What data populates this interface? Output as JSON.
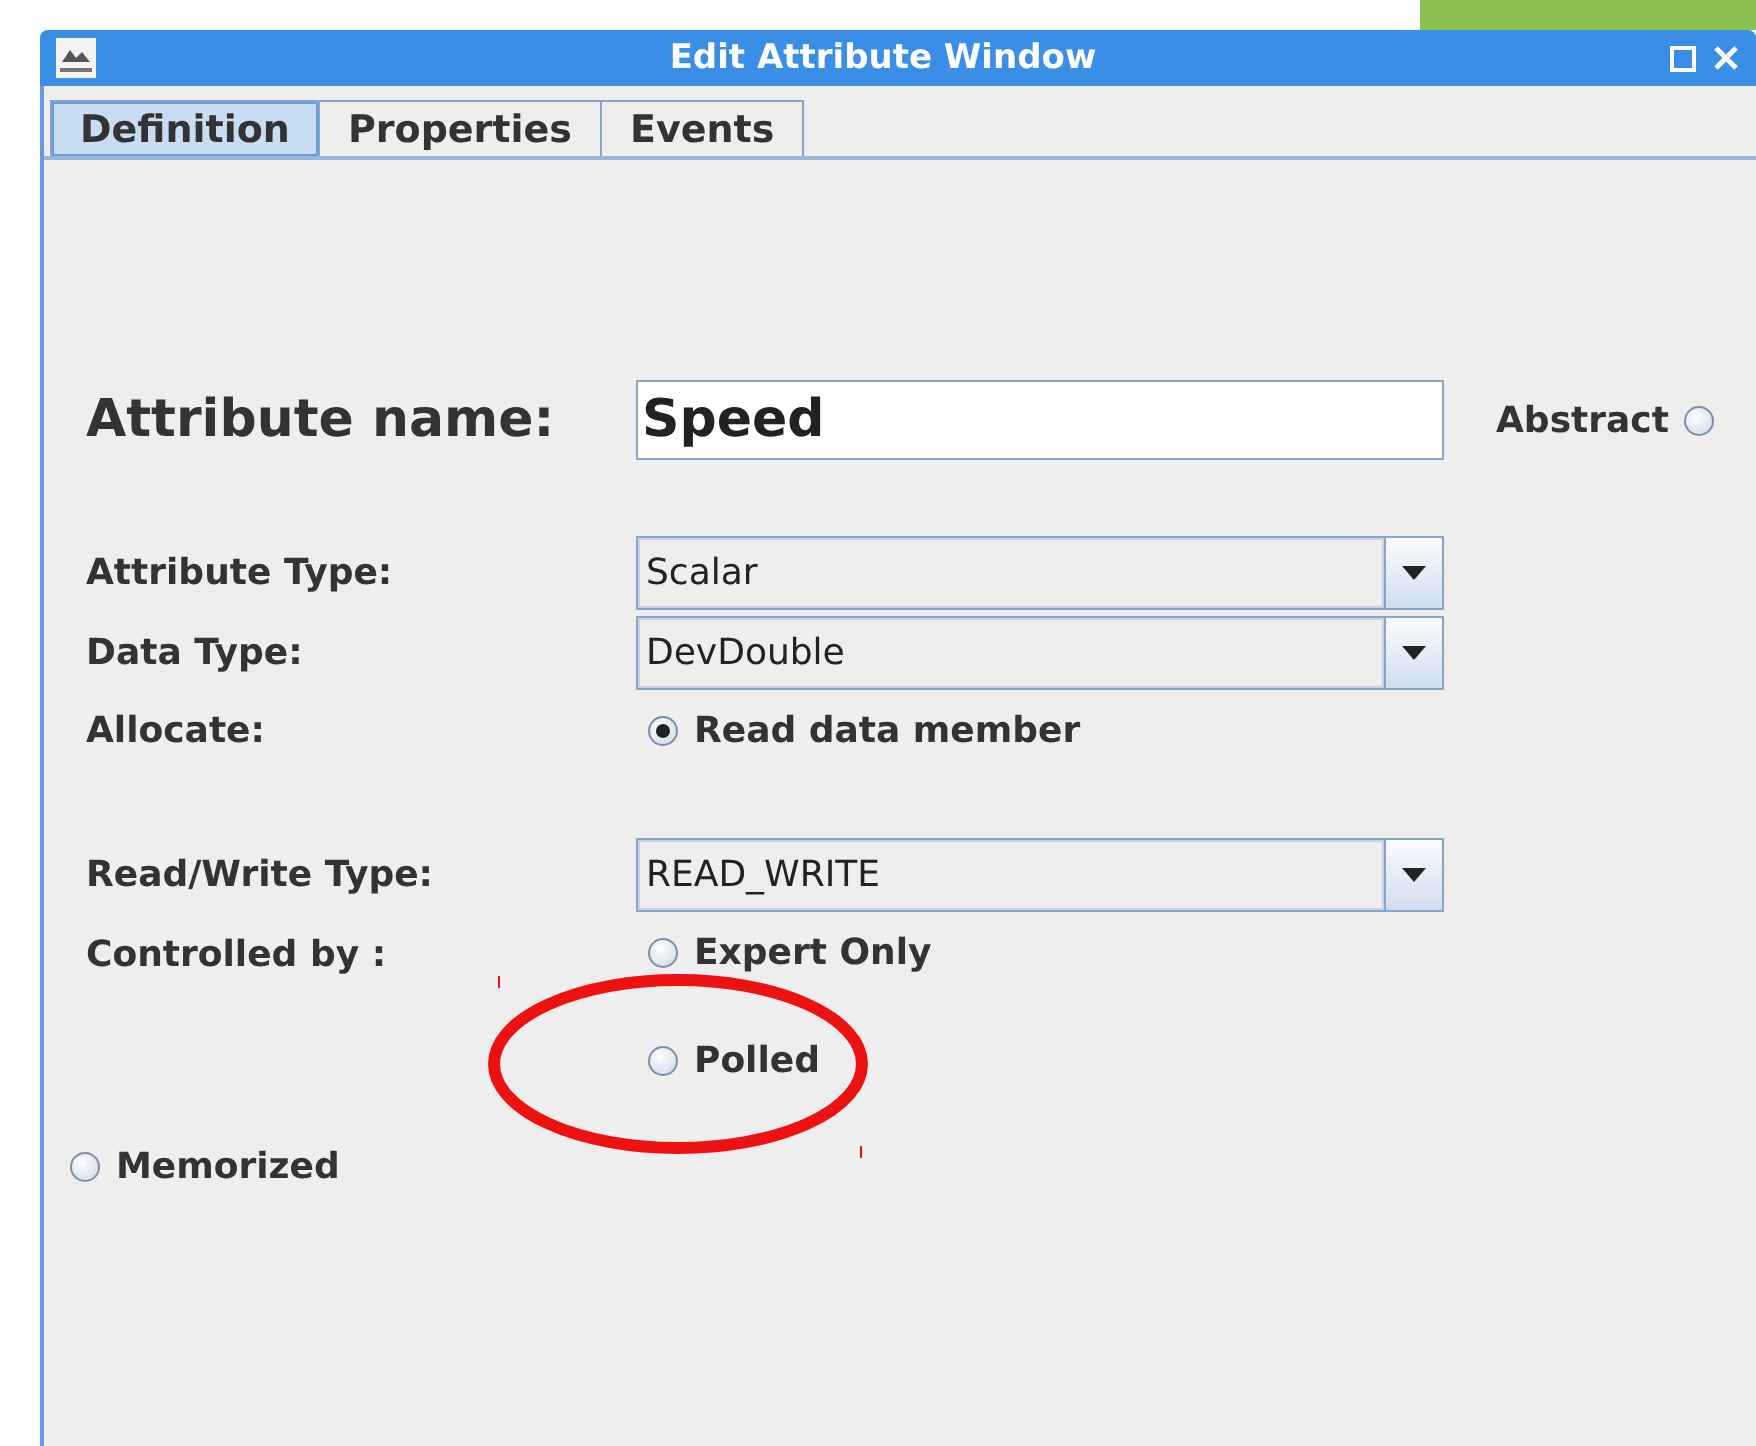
{
  "window": {
    "title": "Edit Attribute Window"
  },
  "tabs": [
    {
      "label": "Definition",
      "selected": true
    },
    {
      "label": "Properties",
      "selected": false
    },
    {
      "label": "Events",
      "selected": false
    }
  ],
  "attribute_name": {
    "label": "Attribute name:",
    "value": "Speed"
  },
  "abstract": {
    "label": "Abstract",
    "checked": false
  },
  "attribute_type": {
    "label": "Attribute Type:",
    "value": "Scalar"
  },
  "data_type": {
    "label": "Data Type:",
    "value": "DevDouble"
  },
  "allocate": {
    "label": "Allocate:",
    "option": "Read data member",
    "checked": true
  },
  "read_write_type": {
    "label": "Read/Write Type:",
    "value": "READ_WRITE"
  },
  "controlled_by": {
    "label": "Controlled by :",
    "option": "Expert Only",
    "checked": false
  },
  "polled": {
    "label": "Polled",
    "checked": false
  },
  "memorized": {
    "label": "Memorized",
    "checked": false
  }
}
